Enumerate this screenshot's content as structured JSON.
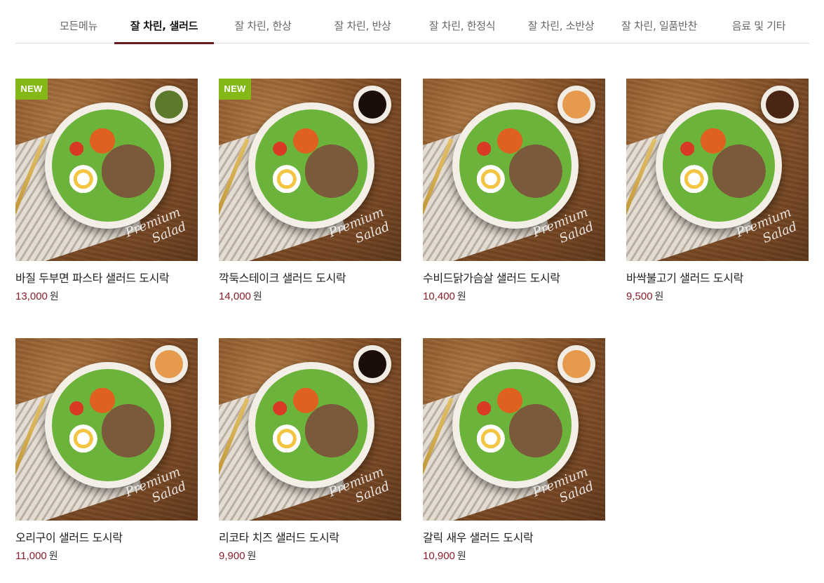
{
  "tabs": [
    {
      "label": "모든메뉴"
    },
    {
      "label": "잘 차린, 샐러드",
      "active": true
    },
    {
      "label": "잘 차린, 한상"
    },
    {
      "label": "잘 차린, 반상"
    },
    {
      "label": "잘 차린, 한정식"
    },
    {
      "label": "잘 차린, 소반상"
    },
    {
      "label": "잘 차린, 일품반찬"
    },
    {
      "label": "음료 및 기타"
    }
  ],
  "products": [
    {
      "name": "바질 두부면 파스타 샐러드 도시락",
      "price": "13,000",
      "unit": "원",
      "badge": "NEW",
      "sauce_color": "#5b7a2a"
    },
    {
      "name": "깍둑스테이크 샐러드 도시락",
      "price": "14,000",
      "unit": "원",
      "badge": "NEW",
      "sauce_color": "#1b0d0a"
    },
    {
      "name": "수비드닭가슴살 샐러드 도시락",
      "price": "10,400",
      "unit": "원",
      "badge": "",
      "sauce_color": "#e59a4e"
    },
    {
      "name": "바싹불고기 샐러드 도시락",
      "price": "9,500",
      "unit": "원",
      "badge": "",
      "sauce_color": "#4a2414"
    },
    {
      "name": "오리구이 샐러드 도시락",
      "price": "11,000",
      "unit": "원",
      "badge": "",
      "sauce_color": "#e59a4e"
    },
    {
      "name": "리코타 치즈 샐러드 도시락",
      "price": "9,900",
      "unit": "원",
      "badge": "",
      "sauce_color": "#1b0d0a"
    },
    {
      "name": "갈릭 새우 샐러드 도시락",
      "price": "10,900",
      "unit": "원",
      "badge": "",
      "sauce_color": "#e59a4e"
    }
  ],
  "image_text": {
    "line1": "Premium",
    "line2": "Salad"
  }
}
